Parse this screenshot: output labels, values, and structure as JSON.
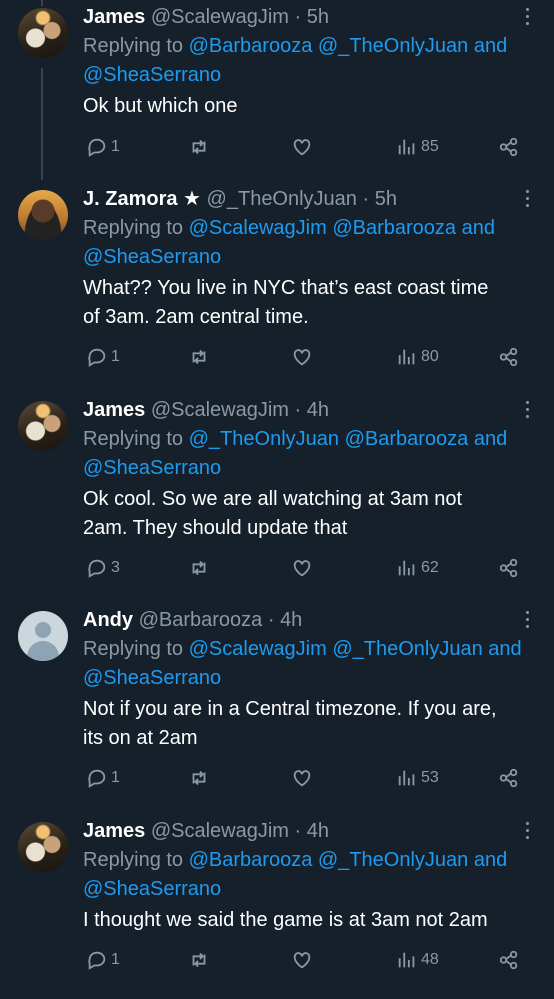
{
  "tweets": [
    {
      "name": "James",
      "handle": "@ScalewagJim",
      "time": "5h",
      "replying_to": "Replying to",
      "mentions": [
        "@Barbarooza",
        "@_TheOnlyJuan",
        "@SheaSerrano"
      ],
      "text_lines": [
        "Ok but which one"
      ],
      "replies": "1",
      "views": "85"
    },
    {
      "name": "J. Zamora",
      "badge": "★",
      "handle": "@_TheOnlyJuan",
      "time": "5h",
      "replying_to": "Replying to",
      "mentions": [
        "@ScalewagJim",
        "@Barbarooza",
        "@SheaSerrano"
      ],
      "text_lines": [
        "What?? You live in NYC that’s east coast time",
        "of 3am. 2am central time."
      ],
      "replies": "1",
      "views": "80"
    },
    {
      "name": "James",
      "handle": "@ScalewagJim",
      "time": "4h",
      "replying_to": "Replying to",
      "mentions": [
        "@_TheOnlyJuan",
        "@Barbarooza",
        "@SheaSerrano"
      ],
      "text_lines": [
        "Ok cool. So we are all watching at 3am not",
        "2am. They should update that"
      ],
      "replies": "3",
      "views": "62"
    },
    {
      "name": "Andy",
      "handle": "@Barbarooza",
      "time": "4h",
      "replying_to": "Replying to",
      "mentions": [
        "@ScalewagJim",
        "@_TheOnlyJuan",
        "@SheaSerrano"
      ],
      "text_lines": [
        "Not if you are in a Central timezone. If you are,",
        "its on at 2am"
      ],
      "replies": "1",
      "views": "53"
    },
    {
      "name": "James",
      "handle": "@ScalewagJim",
      "time": "4h",
      "replying_to": "Replying to",
      "mentions": [
        "@Barbarooza",
        "@_TheOnlyJuan",
        "@SheaSerrano"
      ],
      "text_lines": [
        "I thought we said the game is at 3am not 2am"
      ],
      "replies": "1",
      "views": "48"
    }
  ],
  "common": {
    "and": "and",
    "dot": "·"
  },
  "colors": {
    "background": "#15202b",
    "accent": "#1d9bf0",
    "muted": "#8b98a5",
    "text": "#ffffff"
  },
  "icons": [
    "more-icon",
    "reply-icon",
    "retweet-icon",
    "like-icon",
    "views-icon",
    "share-icon"
  ]
}
